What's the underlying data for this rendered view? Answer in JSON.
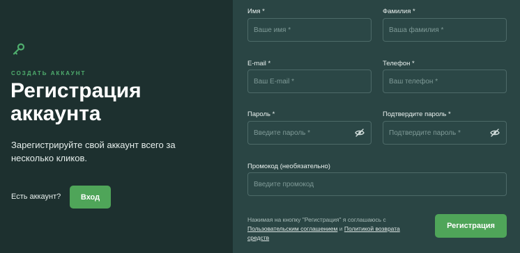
{
  "left": {
    "eyebrow": "СОЗДАТЬ АККАУНТ",
    "title_line1": "Регистрация",
    "title_line2": "аккаунта",
    "subtitle": "Зарегистрируйте свой аккаунт всего за несколько кликов.",
    "have_account": "Есть аккаунт?",
    "login_label": "Вход"
  },
  "form": {
    "first_name": {
      "label": "Имя *",
      "placeholder": "Ваше имя *"
    },
    "last_name": {
      "label": "Фамилия *",
      "placeholder": "Ваша фамилия *"
    },
    "email": {
      "label": "E-mail *",
      "placeholder": "Ваш E-mail *"
    },
    "phone": {
      "label": "Телефон *",
      "placeholder": "Ваш телефон *"
    },
    "password": {
      "label": "Пароль *",
      "placeholder": "Введите пароль *"
    },
    "confirm_password": {
      "label": "Подтвердите пароль *",
      "placeholder": "Подтвердите пароль *"
    },
    "promo": {
      "label": "Промокод (необязательно)",
      "placeholder": "Введите промокод"
    },
    "legal_prefix": "Нажимая на кнопку \"Регистрация\" я соглашаюсь с",
    "legal_link1": "Пользовательским соглашением",
    "legal_and": "и",
    "legal_link2": "Политикой возврата средств",
    "submit_label": "Регистрация"
  },
  "colors": {
    "left_bg": "#1d302f",
    "right_bg": "#2a4544",
    "accent": "#4fa559",
    "eyebrow": "#4fae6e"
  },
  "icons": {
    "key": "key-icon",
    "eye_off": "eye-off-icon"
  }
}
